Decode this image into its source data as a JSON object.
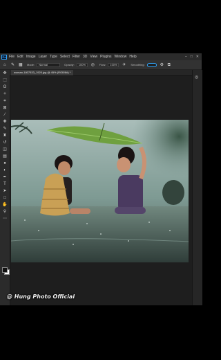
{
  "app": {
    "logo": "Ps",
    "menu": [
      "File",
      "Edit",
      "Image",
      "Layer",
      "Type",
      "Select",
      "Filter",
      "3D",
      "View",
      "Plugins",
      "Window",
      "Help"
    ],
    "window_controls": [
      "–",
      "□",
      "✕"
    ]
  },
  "options": {
    "mode_label": "Mode:",
    "mode_value": "Normal",
    "opacity_label": "Opacity:",
    "opacity_value": "100%",
    "flow_label": "Flow:",
    "flow_value": "100%",
    "smoothing_label": "Smoothing:"
  },
  "document": {
    "tab_title": "woman-1807533_1920.jpg @ 45% (RGB/8#) *"
  },
  "tools": [
    "move-icon",
    "marquee-icon",
    "lasso-icon",
    "quick-select-icon",
    "crop-icon",
    "frame-icon",
    "eyedropper-icon",
    "healing-icon",
    "brush-icon",
    "stamp-icon",
    "history-brush-icon",
    "eraser-icon",
    "gradient-icon",
    "blur-icon",
    "dodge-icon",
    "pen-icon",
    "type-icon",
    "path-select-icon",
    "rectangle-icon",
    "hand-icon",
    "zoom-icon",
    "more-icon"
  ],
  "watermark": {
    "text": "@ Hung Photo Official"
  }
}
